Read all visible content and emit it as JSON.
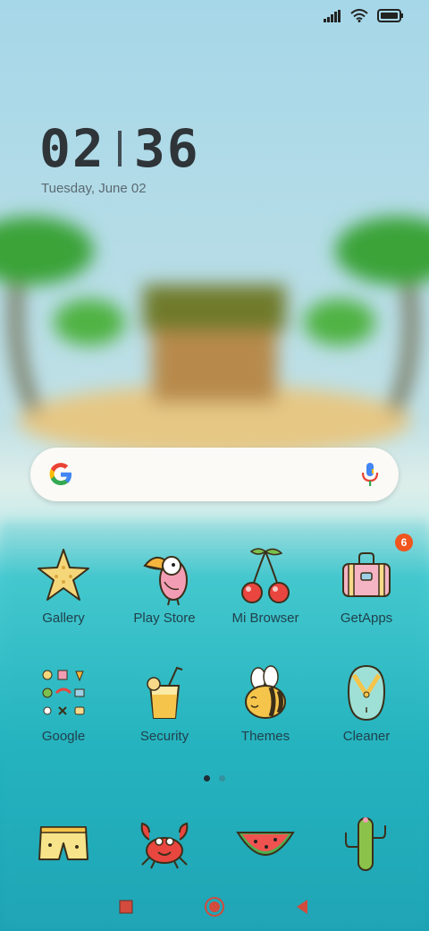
{
  "status_bar": {
    "icons": [
      "signal-icon",
      "wifi-icon",
      "battery-icon"
    ]
  },
  "clock": {
    "hours": "02",
    "minutes": "36",
    "date": "Tuesday, June 02"
  },
  "search": {
    "placeholder": "",
    "left_icon": "google-g-icon",
    "right_icon": "mic-icon"
  },
  "apps_row1": [
    {
      "label": "Gallery",
      "icon": "starfish-icon"
    },
    {
      "label": "Play Store",
      "icon": "toucan-icon"
    },
    {
      "label": "Mi Browser",
      "icon": "cherries-icon"
    },
    {
      "label": "GetApps",
      "icon": "suitcase-icon",
      "badge": "6"
    }
  ],
  "apps_row2": [
    {
      "label": "Google",
      "icon": "app-folder-icon"
    },
    {
      "label": "Security",
      "icon": "juice-icon"
    },
    {
      "label": "Themes",
      "icon": "bee-icon"
    },
    {
      "label": "Cleaner",
      "icon": "flipflop-icon"
    }
  ],
  "page_indicator": {
    "pages": 2,
    "current": 1
  },
  "dock": [
    "shorts-icon",
    "crab-icon",
    "watermelon-icon",
    "cactus-icon"
  ],
  "nav": [
    "recents-button",
    "home-button",
    "back-button"
  ],
  "colors": {
    "badge": "#f0561d",
    "label": "#20414c",
    "sky_top": "#a3d3e6",
    "sea": "#2bb9c4"
  }
}
